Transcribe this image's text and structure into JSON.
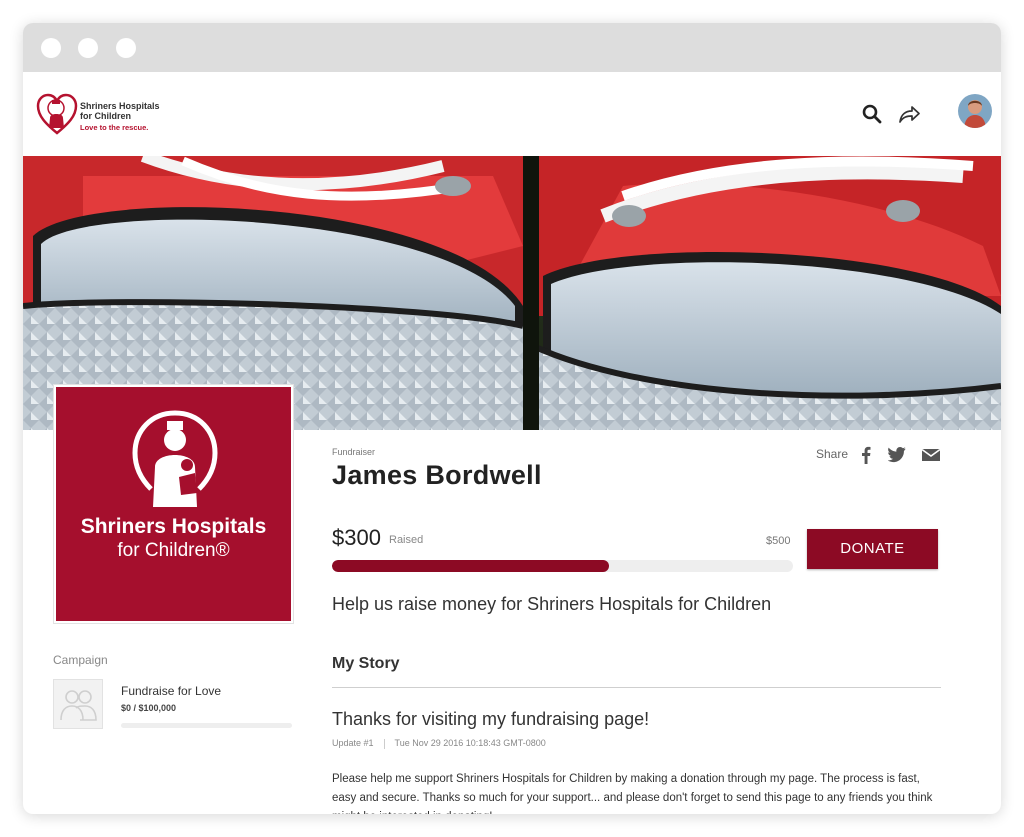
{
  "header": {
    "logo": {
      "line1": "Shriners Hospitals",
      "line2": "for Children",
      "tagline": "Love to the rescue."
    },
    "icons": [
      "search-icon",
      "share-icon",
      "avatar"
    ]
  },
  "hero": {
    "image": "red-sneakers-photo"
  },
  "org_logo": {
    "name_line1": "Shriners Hospitals",
    "name_line2": "for Children®"
  },
  "fundraiser": {
    "label": "Fundraiser",
    "name": "James Bordwell",
    "share_label": "Share",
    "share_icons": [
      "facebook-icon",
      "twitter-icon",
      "email-icon"
    ],
    "raised_amount": "$300",
    "raised_label": "Raised",
    "goal": "$500",
    "progress_fraction": 0.6,
    "donate_label": "DONATE",
    "headline": "Help us raise money for Shriners Hospitals for Children"
  },
  "campaign": {
    "label": "Campaign",
    "name": "Fundraise for Love",
    "amount": "$0 / $100,000",
    "progress_fraction": 0
  },
  "story": {
    "title": "My Story",
    "update_title": "Thanks for visiting my fundraising page!",
    "update_number": "Update #1",
    "update_date": "Tue Nov 29 2016 10:18:43 GMT-0800",
    "body": "Please help me support Shriners Hospitals for Children by making a donation through my page. The process is fast, easy and secure. Thanks so much for your support... and please don't forget to send this page to any friends you think might be interested in donating!"
  },
  "colors": {
    "brand": "#a50f2d",
    "donate": "#8c0a24",
    "progress": "#8c0a24"
  }
}
